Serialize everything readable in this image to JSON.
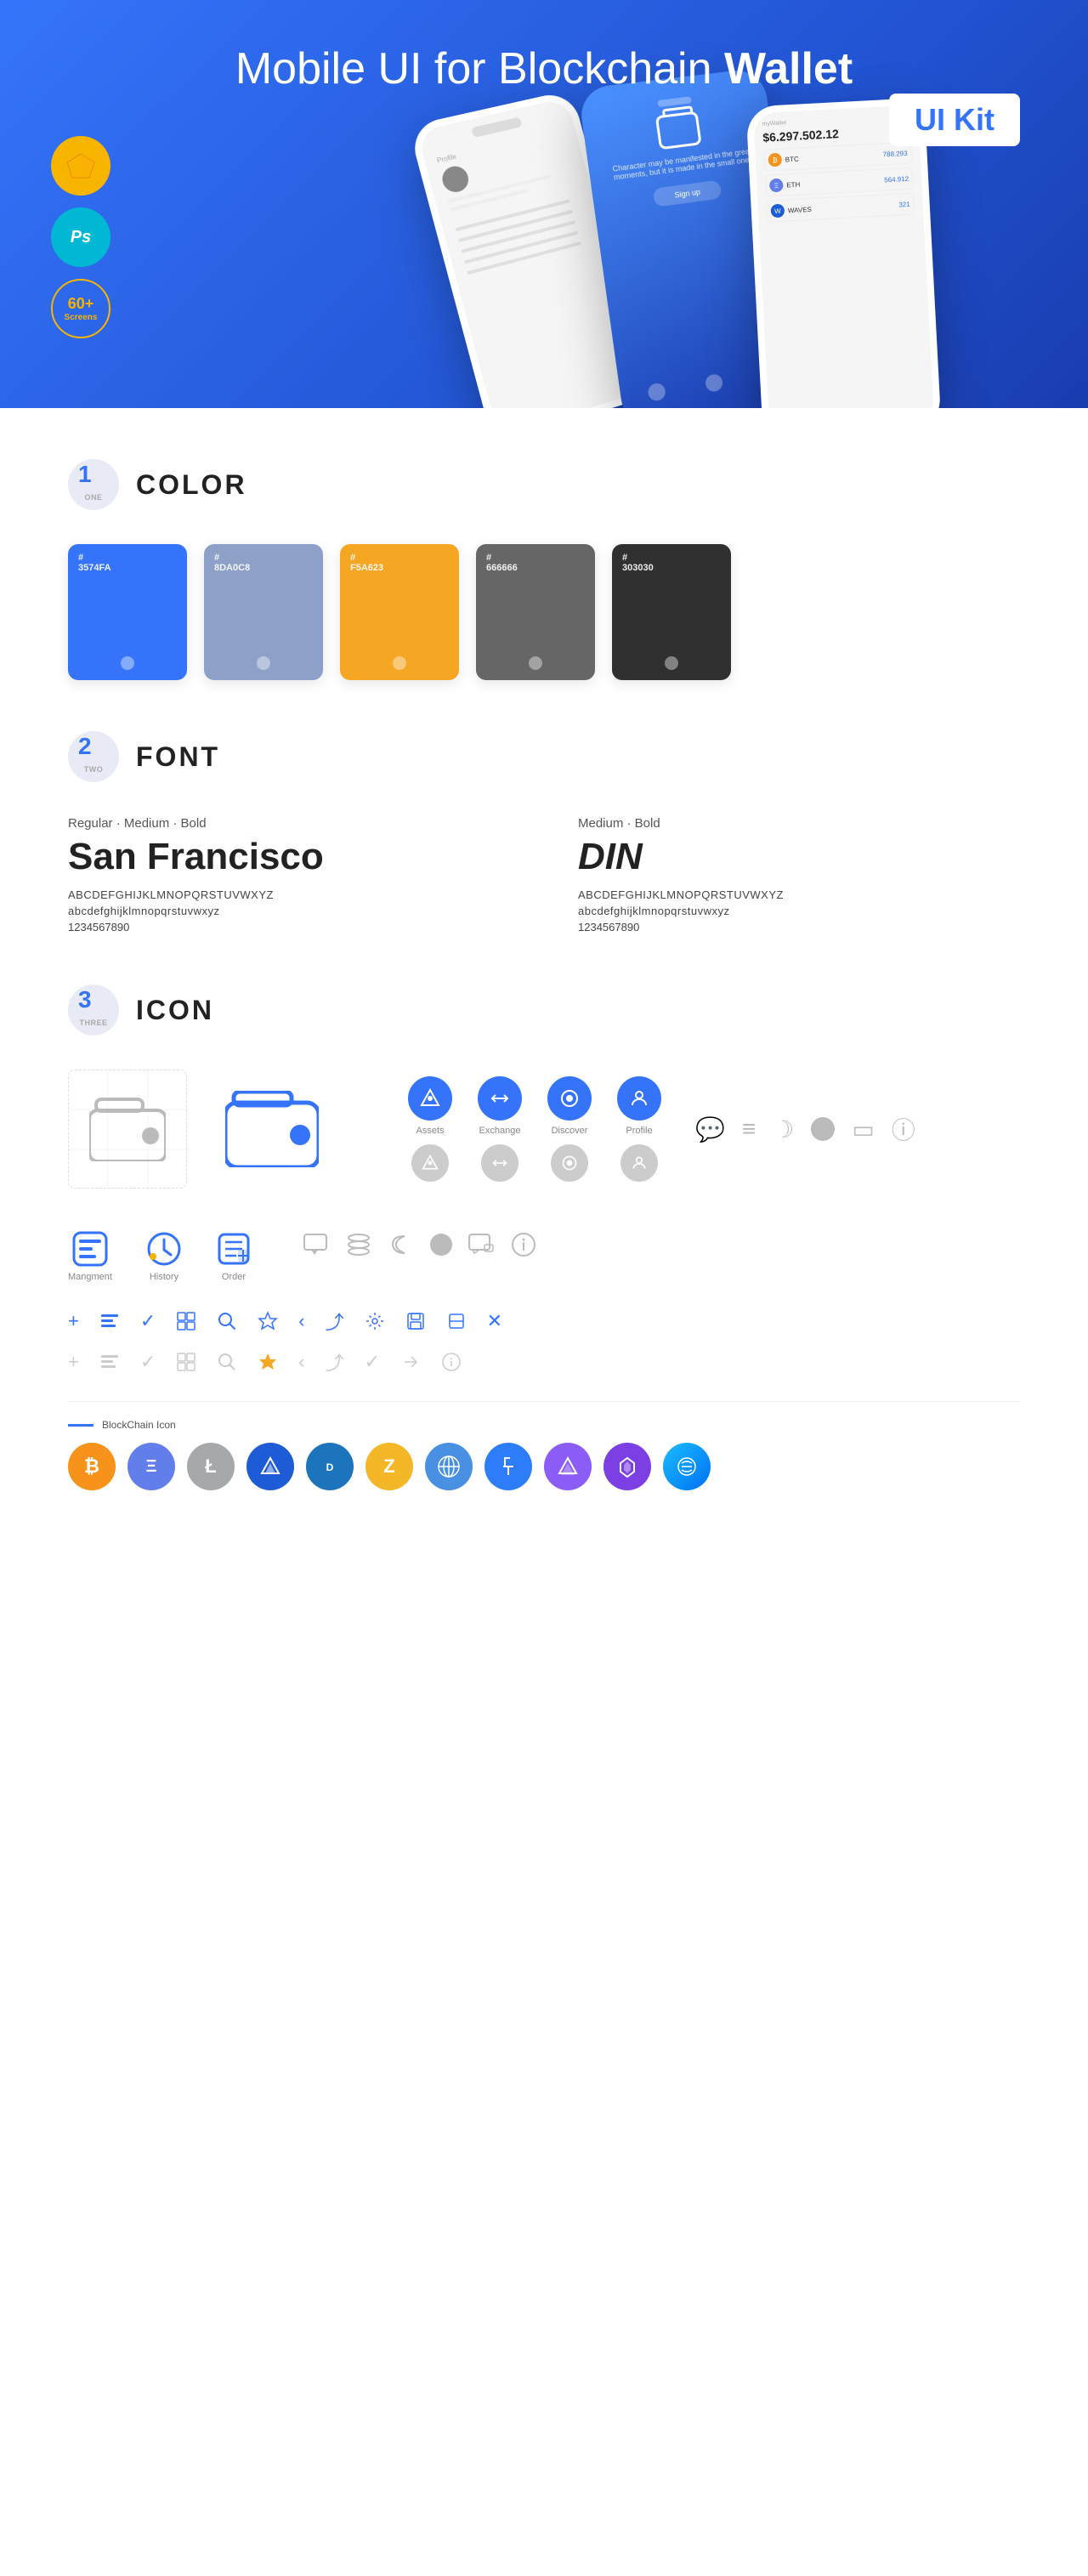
{
  "hero": {
    "title_regular": "Mobile UI for Blockchain ",
    "title_bold": "Wallet",
    "badge": "UI Kit",
    "badges": [
      {
        "label": "Sketch",
        "sublabel": "",
        "type": "sketch"
      },
      {
        "label": "Ps",
        "sublabel": "",
        "type": "ps"
      },
      {
        "label": "60+",
        "sublabel": "Screens",
        "type": "screens"
      }
    ]
  },
  "sections": {
    "color": {
      "number": "1",
      "number_word": "ONE",
      "title": "COLOR",
      "colors": [
        {
          "hex": "#3574FA",
          "display": "#\n3574FA"
        },
        {
          "hex": "#8DA0C8",
          "display": "#\n8DA0C8"
        },
        {
          "hex": "#F5A623",
          "display": "#\nF5A623"
        },
        {
          "hex": "#666666",
          "display": "#\n666666"
        },
        {
          "hex": "#303030",
          "display": "#\n303030"
        }
      ]
    },
    "font": {
      "number": "2",
      "number_word": "TWO",
      "title": "FONT",
      "fonts": [
        {
          "style_label": "Regular · Medium · Bold",
          "name": "San Francisco",
          "uppercase": "ABCDEFGHIJKLMNOPQRSTUVWXYZ",
          "lowercase": "abcdefghijklmnopqrstuvwxyz",
          "numbers": "1234567890"
        },
        {
          "style_label": "Medium · Bold",
          "name": "DIN",
          "uppercase": "ABCDEFGHIJKLMNOPQRSTUVWXYZ",
          "lowercase": "abcdefghijklmnopqrstuvwxyz",
          "numbers": "1234567890"
        }
      ]
    },
    "icon": {
      "number": "3",
      "number_word": "THREE",
      "title": "ICON",
      "nav_icons": [
        {
          "label": "Assets",
          "type": "diamond"
        },
        {
          "label": "Exchange",
          "type": "exchange"
        },
        {
          "label": "Discover",
          "type": "discover"
        },
        {
          "label": "Profile",
          "type": "profile"
        }
      ],
      "bottom_icons": [
        {
          "label": "Mangment",
          "type": "management"
        },
        {
          "label": "History",
          "type": "history"
        },
        {
          "label": "Order",
          "type": "order"
        }
      ],
      "small_icons": [
        "+",
        "list",
        "check",
        "grid",
        "search",
        "star",
        "back",
        "share",
        "settings",
        "save",
        "resize",
        "close"
      ],
      "blockchain_label": "BlockChain Icon",
      "cryptos": [
        {
          "name": "BTC",
          "symbol": "₿"
        },
        {
          "name": "ETH",
          "symbol": "Ξ"
        },
        {
          "name": "LTC",
          "symbol": "Ł"
        },
        {
          "name": "WAVES",
          "symbol": "W"
        },
        {
          "name": "DASH",
          "symbol": "D"
        },
        {
          "name": "ZEC",
          "symbol": "Z"
        },
        {
          "name": "GRID",
          "symbol": "G"
        },
        {
          "name": "XTZ",
          "symbol": "T"
        },
        {
          "name": "ALGO",
          "symbol": "A"
        },
        {
          "name": "MATIC",
          "symbol": "M"
        },
        {
          "name": "OTHER",
          "symbol": "~"
        }
      ]
    }
  }
}
